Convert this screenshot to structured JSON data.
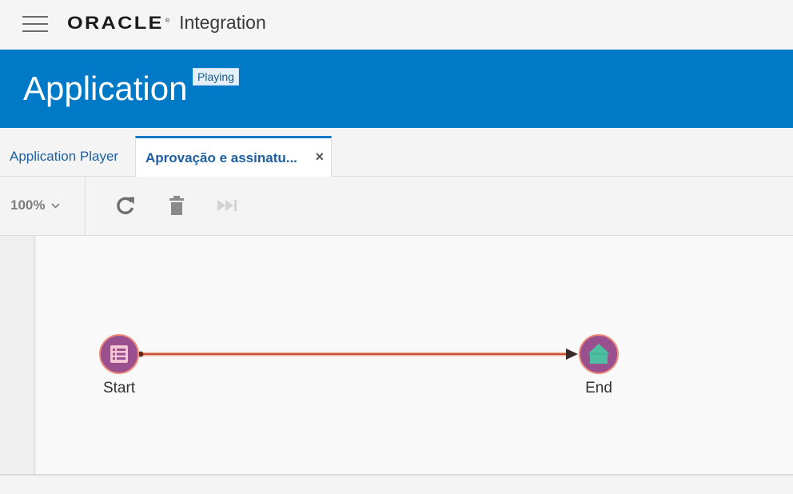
{
  "topbar": {
    "brand_oracle": "ORACLE",
    "brand_reg": "®",
    "product": "Integration"
  },
  "header": {
    "title": "Application",
    "badge": "Playing"
  },
  "tabs": [
    {
      "label": "Application Player",
      "active": false
    },
    {
      "label": "Aprovação e assinatu...",
      "active": true,
      "close": "×"
    }
  ],
  "toolbar": {
    "zoom": "100%",
    "icons": [
      "refresh-icon",
      "delete-icon",
      "skip-forward-icon"
    ]
  },
  "flow": {
    "nodes": [
      {
        "id": "start",
        "label": "Start",
        "icon": "form-icon"
      },
      {
        "id": "end",
        "label": "End",
        "icon": "home-icon"
      }
    ]
  },
  "colors": {
    "header_blue": "#0079c7",
    "node_purple": "#9a4f8f",
    "node_ring": "#f08a7a",
    "connector": "#c8502f",
    "end_teal": "#4dbfa0"
  }
}
